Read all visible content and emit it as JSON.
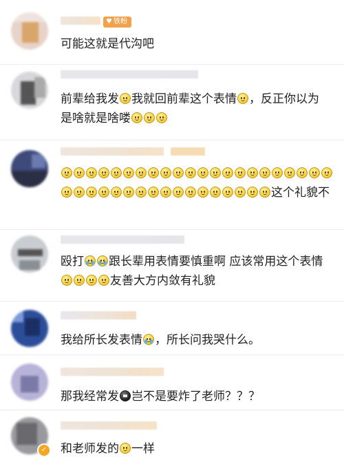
{
  "comments": [
    {
      "badge": "铁粉",
      "text": "可能这就是代沟吧"
    },
    {
      "text_parts": [
        "前辈给我发",
        "我就回前辈这个表情",
        "，反正你以为是啥就是啥喽"
      ]
    },
    {
      "text_parts": [
        "这个礼貌不"
      ],
      "emoji_count": 39
    },
    {
      "text_parts": [
        "殴打",
        "跟长辈用表情要慎重啊 应该常用这个表情",
        "友善大方内敛有礼貌"
      ]
    },
    {
      "text_parts": [
        "我给所长发表情",
        "，所长问我哭什么。"
      ]
    },
    {
      "text_parts": [
        "那我经常发",
        "岂不是要炸了老师？？？"
      ]
    },
    {
      "text_parts": [
        "和老师发的",
        "一样"
      ]
    }
  ],
  "colors": {
    "badge": "#f3a24b",
    "text": "#222222",
    "divider": "#eeeeee"
  },
  "icons": {
    "smile": "smile-emoji-icon",
    "cry": "laugh-cry-emoji-icon",
    "bomb": "bomb-emoji-icon",
    "vip": "verified-badge-icon"
  }
}
